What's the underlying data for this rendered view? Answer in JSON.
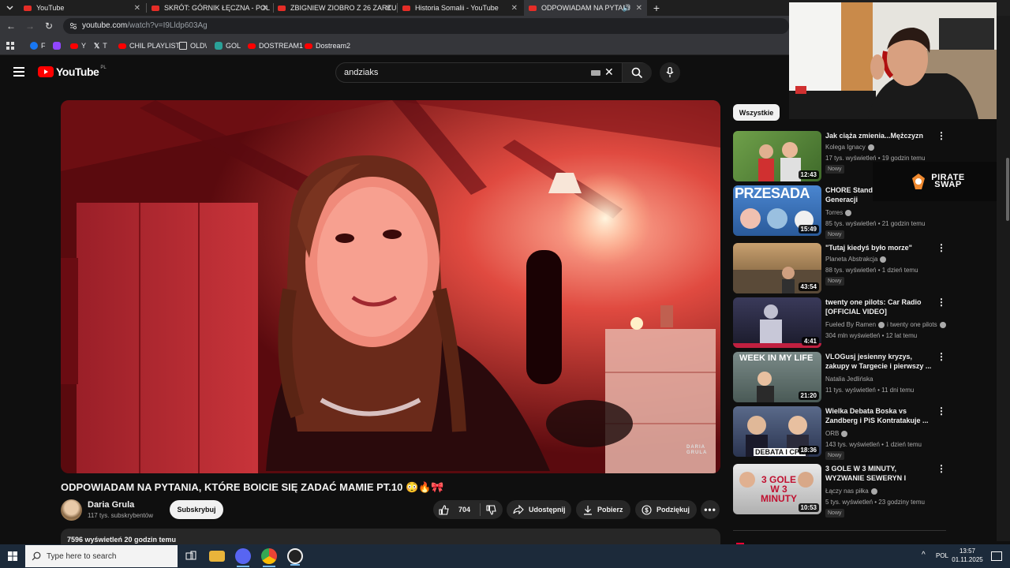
{
  "browser": {
    "tabs": [
      {
        "title": "YouTube"
      },
      {
        "title": "SKRÓT: GÓRNIK ŁĘCZNA - POL"
      },
      {
        "title": "ZBIGNIEW ZIOBRO Z 26 ZARZU"
      },
      {
        "title": "Historia Somalii - YouTube"
      },
      {
        "title": "ODPOWIADAM NA PYTANI"
      }
    ],
    "new_tab_label": "+",
    "url_host": "youtube.com",
    "url_path": "/watch?v=I9Lldp603Ag",
    "bookmarks": [
      {
        "label": "F",
        "color": "#1877f2"
      },
      {
        "label": "",
        "color": "#9146ff"
      },
      {
        "label": "Y",
        "color": "#ff0000"
      },
      {
        "label": "T",
        "color": "#000000"
      },
      {
        "label": "CHIL PLAYLIST",
        "color": "#ff0000"
      },
      {
        "label": "OLD\\",
        "color": "#888888"
      },
      {
        "label": "GOL",
        "color": "#2aa198"
      },
      {
        "label": "DOSTREAM1",
        "color": "#ff0000"
      },
      {
        "label": "Dostream2",
        "color": "#ff0000"
      }
    ]
  },
  "youtube": {
    "logo_text": "YouTube",
    "country_code": "PL",
    "search_value": "andziaks",
    "video": {
      "watermark_line1": "DARIA",
      "watermark_line2": "GRULA"
    },
    "title": "ODPOWIADAM NA PYTANIA, KTÓRE BOICIE SIĘ ZADAĆ MAMIE PT.10 😳🔥🎀",
    "channel": {
      "name": "Daria Grula",
      "subscribers": "117 tys. subskrybentów",
      "subscribe_label": "Subskrybuj"
    },
    "actions": {
      "likes": "704",
      "share": "Udostępnij",
      "download": "Pobierz",
      "thanks": "Podziękuj"
    },
    "description": {
      "views_time": "7596 wyświetleń  20 godzin temu"
    },
    "filter_chip": "Wszystkie",
    "recommendations": [
      {
        "title": "Jak ciąża zmienia...Mężczyzn",
        "channel": "Kolega Ignacy",
        "verified": true,
        "meta": "17 tys. wyświetleń • 19 godzin temu",
        "badge": "Nowy",
        "duration": "12:43",
        "thumb_color": "#4f7a3a"
      },
      {
        "title": "CHORE Standa Naszej Generacji",
        "channel": "Torres",
        "verified": true,
        "meta": "85 tys. wyświetleń • 21 godzin temu",
        "badge": "Nowy",
        "duration": "15:49",
        "thumb_color": "#3a72b8",
        "thumb_text": "PRZESADA"
      },
      {
        "title": "\"Tutaj kiedyś było morze\"",
        "channel": "Planeta Abstrakcja",
        "verified": true,
        "meta": "88 tys. wyświetleń • 1 dzień temu",
        "badge": "Nowy",
        "duration": "43:54",
        "thumb_color": "#8a6b45"
      },
      {
        "title": "twenty one pilots: Car Radio [OFFICIAL VIDEO]",
        "channel": "Fueled By Ramen",
        "verified": true,
        "channel_extra": "i twenty one pilots",
        "meta": "304 mln wyświetleń • 12 lat temu",
        "badge": "",
        "duration": "4:41",
        "thumb_color": "#2a2a3a"
      },
      {
        "title": "VLOGusj jesienny kryzys, zakupy w Targecie i pierwszy ...",
        "channel": "Natalia Jedlińska",
        "verified": false,
        "meta": "11 tys. wyświetleń • 11 dni temu",
        "badge": "",
        "duration": "21:20",
        "thumb_color": "#5c6f66",
        "thumb_text": "WEEK IN MY LIFE"
      },
      {
        "title": "Wielka Debata Boska vs Zandberg i PiS Kontratakuje ...",
        "channel": "ORB",
        "verified": true,
        "meta": "143 tys. wyświetleń • 1 dzień temu",
        "badge": "Nowy",
        "duration": "18:36",
        "thumb_color": "#3b4a6a",
        "thumb_text": "DEBATA I CPK"
      },
      {
        "title": "3 GOLE W 3 MINUTY, WYZWANIE SEWERYN I NOWA...",
        "channel": "Łączy nas piłka",
        "verified": true,
        "meta": "5 tys. wyświetleń • 23 godziny temu",
        "badge": "Nowy",
        "duration": "10:53",
        "thumb_color": "#c9c9c9",
        "thumb_text": "3 GOLE W 3 MINUTY"
      }
    ]
  },
  "overlay": {
    "sponsor_line1": "PIRATE",
    "sponsor_line2": "SWAP",
    "webcam_corner_text": "adki"
  },
  "taskbar": {
    "search_placeholder": "Type here to search",
    "language": "POL",
    "time": "13:57",
    "date": "01.11.2025"
  }
}
